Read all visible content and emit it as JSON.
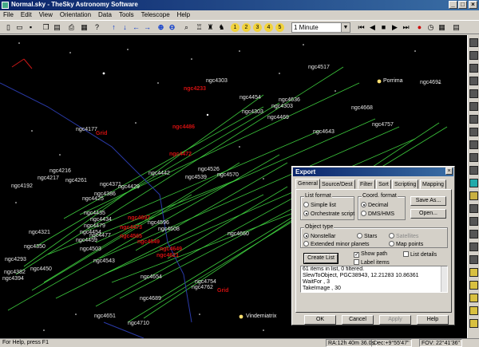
{
  "window": {
    "title": "Normal.sky - TheSky Astronomy Software"
  },
  "menu": [
    "File",
    "Edit",
    "View",
    "Orientation",
    "Data",
    "Tools",
    "Telescope",
    "Help"
  ],
  "toolbar": {
    "time_step": "1 Minute"
  },
  "sky": {
    "galaxies": [
      {
        "name": "ngc4517"
      },
      {
        "name": "ngc4303"
      },
      {
        "name": "ngc4691"
      },
      {
        "name": "ngc4454"
      },
      {
        "name": "ngc4303"
      },
      {
        "name": "ngc4636"
      },
      {
        "name": "ngc4303"
      },
      {
        "name": "ngc4668"
      },
      {
        "name": "ngc4469"
      },
      {
        "name": "ngc4757"
      },
      {
        "name": "ngc4177"
      },
      {
        "name": "ngc4643"
      },
      {
        "name": "ngc4216"
      },
      {
        "name": "ngc4217"
      },
      {
        "name": "ngc4261"
      },
      {
        "name": "ngc4442"
      },
      {
        "name": "ngc4526"
      },
      {
        "name": "ngc4570"
      },
      {
        "name": "ngc4192"
      },
      {
        "name": "ngc4371"
      },
      {
        "name": "ngc4429"
      },
      {
        "name": "ngc4539"
      },
      {
        "name": "ngc4386"
      },
      {
        "name": "ngc4425"
      },
      {
        "name": "ngc4435"
      },
      {
        "name": "ngc4434"
      },
      {
        "name": "ngc4479"
      },
      {
        "name": "ngc4454"
      },
      {
        "name": "ngc4477"
      },
      {
        "name": "ngc4459"
      },
      {
        "name": "ngc4596"
      },
      {
        "name": "ngc4608"
      },
      {
        "name": "ngc4321"
      },
      {
        "name": "ngc4350"
      },
      {
        "name": "ngc4293"
      },
      {
        "name": "ngc4503"
      },
      {
        "name": "ngc4660"
      },
      {
        "name": "ngc4543"
      },
      {
        "name": "ngc4382"
      },
      {
        "name": "ngc4394"
      },
      {
        "name": "ngc4450"
      },
      {
        "name": "ngc4654"
      },
      {
        "name": "ngc4754"
      },
      {
        "name": "ngc4762"
      },
      {
        "name": "ngc4689"
      },
      {
        "name": "ngc4651"
      },
      {
        "name": "ngc4710"
      }
    ],
    "red_objects": [
      {
        "name": "ngc4233"
      },
      {
        "name": "ngc4486"
      },
      {
        "name": "ngc4472"
      },
      {
        "name": "ngc4697"
      },
      {
        "name": "ngc4565"
      },
      {
        "name": "ngc4473"
      },
      {
        "name": "ngc4649"
      },
      {
        "name": "ngc4621"
      },
      {
        "name": "ngc4649"
      },
      {
        "name": "Grid"
      },
      {
        "name": "Grid"
      }
    ],
    "stars": [
      {
        "name": "Porrima"
      },
      {
        "name": "Vindemiatrix"
      }
    ]
  },
  "dialog": {
    "title": "Export",
    "tabs": [
      "General",
      "Source/Dest",
      "Filter",
      "Sort",
      "Scripting",
      "Mapping"
    ],
    "list_format": {
      "label": "List format",
      "options": [
        "Simple list",
        "Orchestrate script"
      ],
      "selected": 1
    },
    "coord_format": {
      "label": "Coord. format",
      "options": [
        "Decimal",
        "DMS/HMS"
      ],
      "selected": 0
    },
    "save_as": "Save As...",
    "open": "Open...",
    "object_type": {
      "label": "Object type",
      "options": [
        "Nonstellar",
        "Stars",
        "Extended minor planets",
        "Map points"
      ],
      "disabled_option": "Satellites",
      "selected": 0
    },
    "create_list": "Create List",
    "show_path": "Show path",
    "label_items": "Label items",
    "list_details": "List details",
    "list_lines": [
      "61 items in list, 0 filtered.",
      "SlewToObject, PGC38943,  12.21283  10.86361",
      "WaitFor      , 3",
      "TakeImage    , 30"
    ],
    "ok": "OK",
    "cancel": "Cancel",
    "apply": "Apply",
    "help": "Help"
  },
  "status": {
    "help": "For Help, press F1",
    "ra": "RA:12h 40m 36.0s",
    "dec": "Dec:+9°55'47\"",
    "fov": "FOV: 22°41'36\""
  }
}
